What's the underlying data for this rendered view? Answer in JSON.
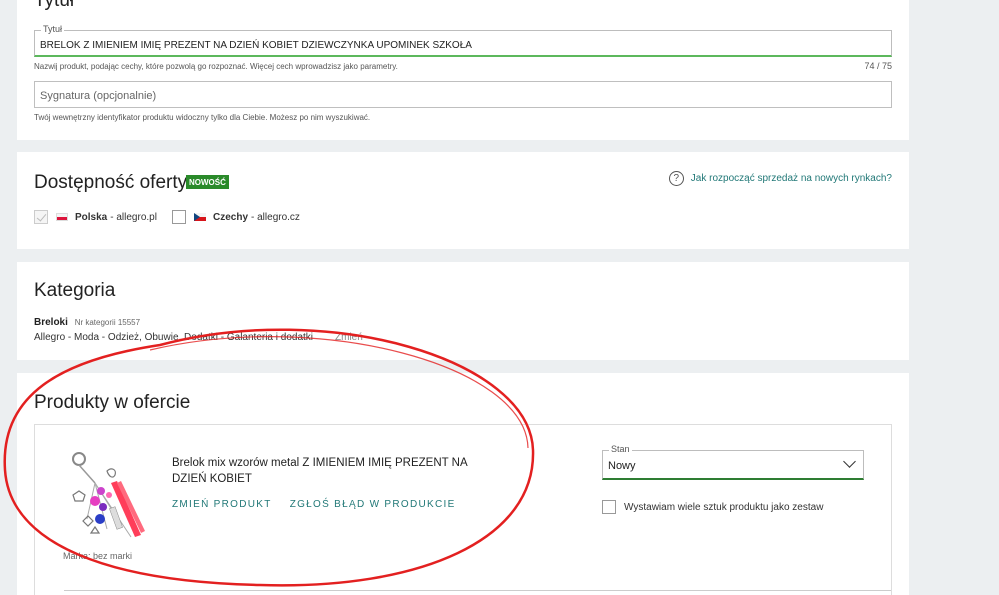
{
  "title_section": {
    "heading": "Tytuł",
    "title_field": {
      "legend": "Tytuł",
      "value": "BRELOK Z IMIENIEM IMIĘ PREZENT NA DZIEŃ KOBIET DZIEWCZYNKA UPOMINEK SZKOŁA"
    },
    "title_helper": "Nazwij produkt, podając cechy, które pozwolą go rozpoznać. Więcej cech wprowadzisz jako parametry.",
    "counter": "74  /  75",
    "signature_field": {
      "placeholder": "Sygnatura (opcjonalnie)"
    },
    "signature_helper": "Twój wewnętrzny identyfikator produktu widoczny tylko dla Ciebie. Możesz po nim wyszukiwać."
  },
  "availability": {
    "heading": "Dostępność oferty",
    "badge": "NOWOŚĆ",
    "help_link": "Jak rozpocząć sprzedaż na nowych rynkach?",
    "markets": [
      {
        "country": "Polska",
        "site": " - allegro.pl",
        "checked": true,
        "disabled": true
      },
      {
        "country": "Czechy",
        "site": " - allegro.cz",
        "checked": false,
        "disabled": false
      }
    ]
  },
  "category": {
    "heading": "Kategoria",
    "name": "Breloki",
    "number": "Nr kategorii 15557",
    "path": "Allegro - Moda - Odzież, Obuwie, Dodatki - Galanteria i dodatki",
    "change": "Zmień"
  },
  "products": {
    "heading": "Produkty w ofercie",
    "product_name": "Brelok mix wzorów metal Z IMIENIEM IMIĘ PREZENT NA DZIEŃ KOBIET",
    "change_product": "ZMIEŃ PRODUKT",
    "report_error": "ZGŁOŚ BŁĄD W PRODUKCIE",
    "brand": "Marka: bez marki",
    "condition_legend": "Stan",
    "condition_value": "Nowy",
    "set_option": "Wystawiam wiele sztuk produktu jako zestaw"
  },
  "colors": {
    "accent": "#217877",
    "badge": "#2a8a2a",
    "annotation": "#e32020",
    "input_focus": "#5cb85c"
  }
}
